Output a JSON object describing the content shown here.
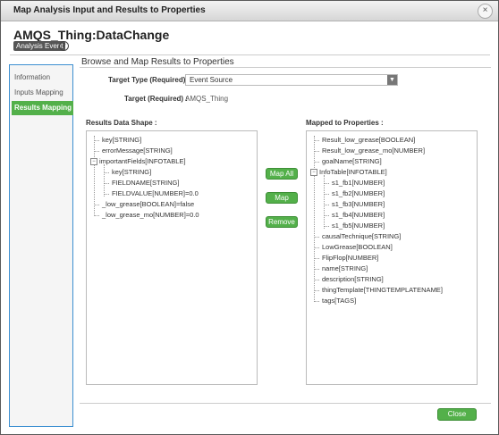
{
  "window": {
    "title": "Map Analysis Input and Results to Properties",
    "close_glyph": "×"
  },
  "header": {
    "name": "AMQS_Thing:DataChange",
    "badge": "Analysis Event",
    "help_glyph": "?"
  },
  "sidebar": {
    "items": [
      {
        "label": "Information"
      },
      {
        "label": "Inputs Mapping"
      },
      {
        "label": "Results Mapping",
        "active": true
      }
    ]
  },
  "main": {
    "title": "Browse and Map Results to Properties",
    "target_type_label": "Target Type (Required) :",
    "target_type_value": "Event Source",
    "target_label": "Target (Required) :",
    "target_value": "AMQS_Thing",
    "results_label": "Results Data Shape :",
    "mapped_label": "Mapped to Properties :"
  },
  "results_tree": [
    {
      "text": "key[STRING]",
      "depth": 0
    },
    {
      "text": "errorMessage[STRING]",
      "depth": 0
    },
    {
      "text": "importantFields[INFOTABLE]",
      "depth": 0,
      "expander": "−"
    },
    {
      "text": "key[STRING]",
      "depth": 1
    },
    {
      "text": "FIELDNAME[STRING]",
      "depth": 1
    },
    {
      "text": "FIELDVALUE[NUMBER]=0.0",
      "depth": 1
    },
    {
      "text": "_low_grease[BOOLEAN]=false",
      "depth": 0
    },
    {
      "text": "_low_grease_mo[NUMBER]=0.0",
      "depth": 0
    }
  ],
  "mapped_tree": [
    {
      "text": "Result_low_grease[BOOLEAN]",
      "depth": 0
    },
    {
      "text": "Result_low_grease_mo[NUMBER]",
      "depth": 0
    },
    {
      "text": "goalName[STRING]",
      "depth": 0
    },
    {
      "text": "InfoTable[INFOTABLE]",
      "depth": 0,
      "expander": "−"
    },
    {
      "text": "s1_fb1[NUMBER]",
      "depth": 1
    },
    {
      "text": "s1_fb2[NUMBER]",
      "depth": 1
    },
    {
      "text": "s1_fb3[NUMBER]",
      "depth": 1
    },
    {
      "text": "s1_fb4[NUMBER]",
      "depth": 1
    },
    {
      "text": "s1_fb5[NUMBER]",
      "depth": 1
    },
    {
      "text": "causalTechnique[STRING]",
      "depth": 0
    },
    {
      "text": "LowGrease[BOOLEAN]",
      "depth": 0
    },
    {
      "text": "FlipFlop[NUMBER]",
      "depth": 0
    },
    {
      "text": "name[STRING]",
      "depth": 0
    },
    {
      "text": "description[STRING]",
      "depth": 0
    },
    {
      "text": "thingTemplate[THINGTEMPLATENAME]",
      "depth": 0
    },
    {
      "text": "tags[TAGS]",
      "depth": 0
    }
  ],
  "buttons": {
    "map_all": "Map All",
    "map": "Map",
    "remove": "Remove",
    "close": "Close"
  },
  "colors": {
    "accent_green": "#53b04a",
    "sidebar_border": "#3c8fd1"
  }
}
